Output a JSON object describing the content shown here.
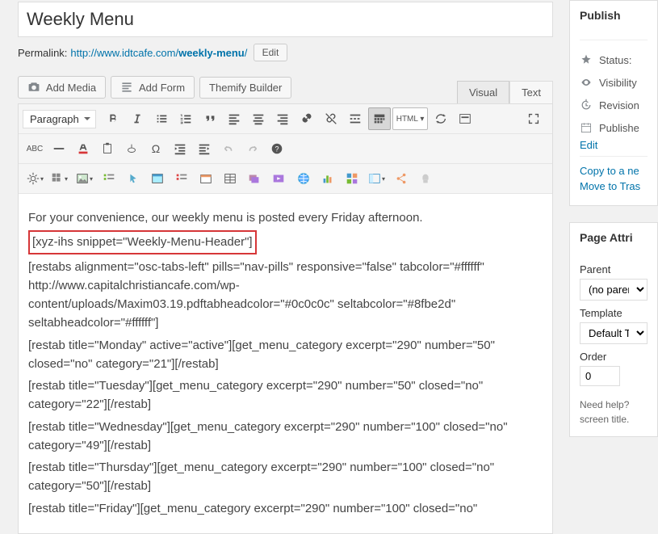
{
  "title": "Weekly Menu",
  "permalink": {
    "label": "Permalink:",
    "base": "http://www.idtcafe.com/",
    "slug": "weekly-menu",
    "slash": "/",
    "edit": "Edit"
  },
  "media": {
    "add_media": "Add Media",
    "add_form": "Add Form",
    "themify": "Themify Builder"
  },
  "tabs": {
    "visual": "Visual",
    "text": "Text"
  },
  "toolbar": {
    "paragraph": "Paragraph"
  },
  "content": {
    "intro": "For your convenience, our weekly menu is posted every Friday afternoon.",
    "highlight": "[xyz-ihs snippet=\"Weekly-Menu-Header\"]",
    "blank1": " ",
    "l1": "[restabs alignment=\"osc-tabs-left\" pills=\"nav-pills\" responsive=\"false\" tabcolor=\"#ffffff\" http://www.capitalchristiancafe.com/wp-content/uploads/Maxim03.19.pdftabheadcolor=\"#0c0c0c\" seltabcolor=\"#8fbe2d\" seltabheadcolor=\"#ffffff\"]",
    "l2": "[restab title=\"Monday\" active=\"active\"][get_menu_category excerpt=\"290\" number=\"50\" closed=\"no\" category=\"21\"][/restab]",
    "l3": "[restab title=\"Tuesday\"][get_menu_category excerpt=\"290\" number=\"50\" closed=\"no\" category=\"22\"][/restab]",
    "l4": "[restab title=\"Wednesday\"][get_menu_category excerpt=\"290\" number=\"100\" closed=\"no\" category=\"49\"][/restab]",
    "l5": "[restab title=\"Thursday\"][get_menu_category excerpt=\"290\" number=\"100\" closed=\"no\" category=\"50\"][/restab]",
    "l6": "[restab title=\"Friday\"][get_menu_category excerpt=\"290\" number=\"100\" closed=\"no\""
  },
  "publish": {
    "heading": "Publish",
    "status": "Status:",
    "visibility": "Visibility",
    "revisions": "Revision",
    "published": "Publishe",
    "edit": "Edit",
    "copy_draft": "Copy to a ne",
    "move_trash": "Move to Tras"
  },
  "attrs": {
    "heading": "Page Attri",
    "parent_label": "Parent",
    "parent_val": "(no paren",
    "template_label": "Template",
    "template_val": "Default Te",
    "order_label": "Order",
    "order_val": "0",
    "help": "Need help? screen title."
  }
}
